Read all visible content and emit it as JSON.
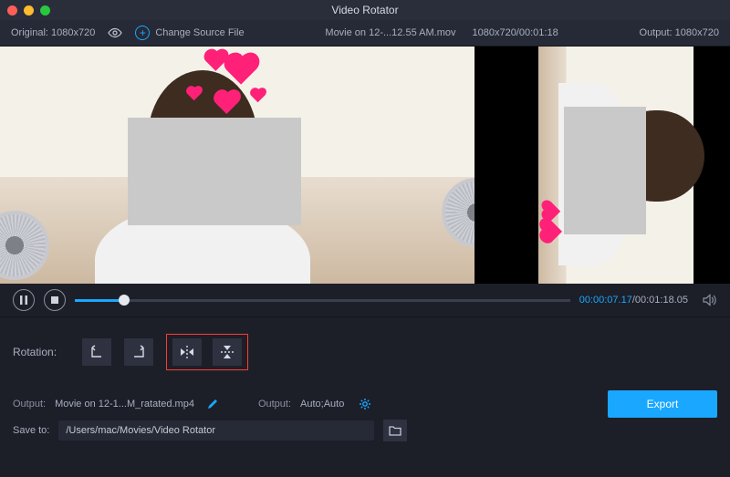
{
  "app": {
    "title": "Video Rotator"
  },
  "info": {
    "original_label": "Original: 1080x720",
    "change_source_label": "Change Source File",
    "filename": "Movie on 12-...12.55 AM.mov",
    "dims_time": "1080x720/00:01:18",
    "output_label": "Output: 1080x720"
  },
  "playback": {
    "current": "00:00:07.17",
    "total": "/00:01:18.05"
  },
  "rotation": {
    "label": "Rotation:"
  },
  "output": {
    "label1": "Output:",
    "filename": "Movie on 12-1...M_ratated.mp4",
    "label2": "Output:",
    "preset": "Auto;Auto"
  },
  "save": {
    "label": "Save to:",
    "path": "/Users/mac/Movies/Video Rotator"
  },
  "export": {
    "label": "Export"
  }
}
